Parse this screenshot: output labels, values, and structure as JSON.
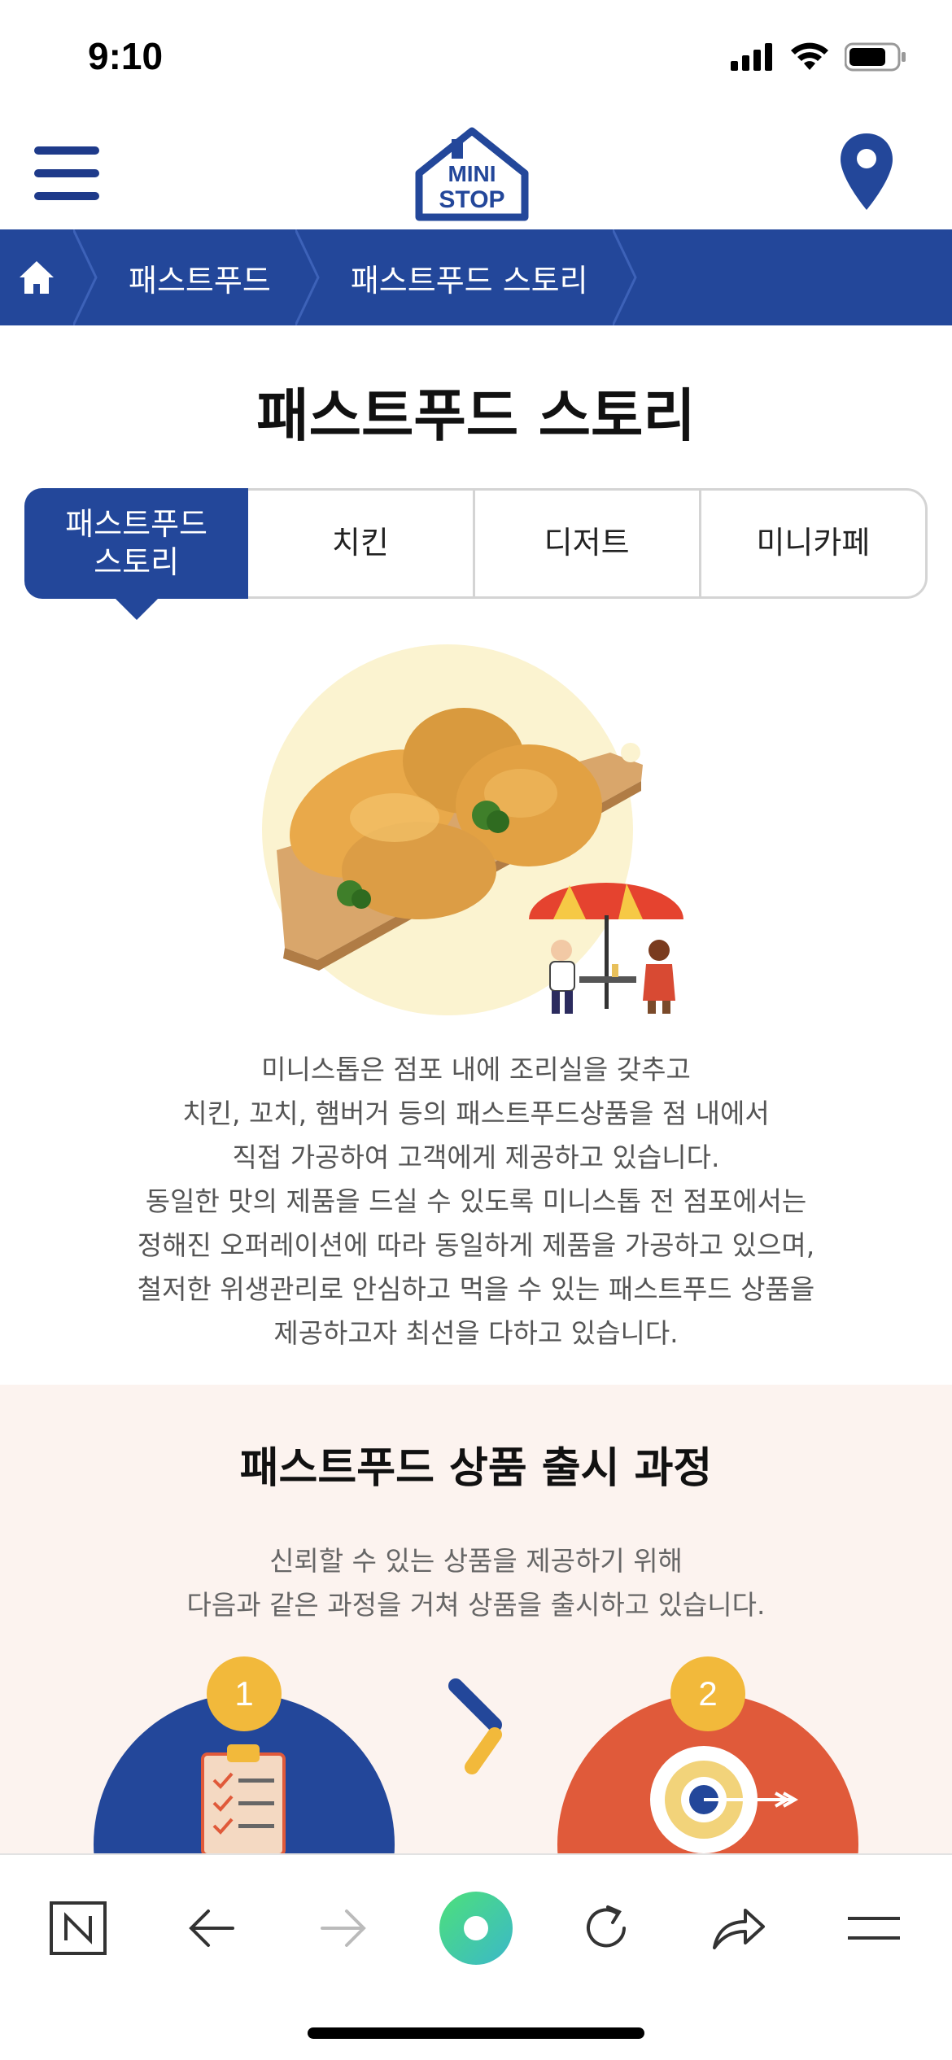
{
  "status_bar": {
    "time": "9:10"
  },
  "header": {
    "logo_text_top": "MINI",
    "logo_text_bottom": "STOP"
  },
  "breadcrumb": {
    "items": [
      "패스트푸드",
      "패스트푸드 스토리"
    ]
  },
  "page": {
    "title": "패스트푸드 스토리"
  },
  "tabs": [
    {
      "label": "패스트푸드\n스토리",
      "active": true
    },
    {
      "label": "치킨",
      "active": false
    },
    {
      "label": "디저트",
      "active": false
    },
    {
      "label": "미니카페",
      "active": false
    }
  ],
  "intro": {
    "lines": [
      "미니스톱은 점포 내에 조리실을 갖추고",
      "치킨, 꼬치, 햄버거 등의 패스트푸드상품을 점 내에서",
      "직접 가공하여 고객에게 제공하고 있습니다.",
      "동일한 맛의 제품을 드실 수 있도록 미니스톱 전 점포에서는",
      "정해진 오퍼레이션에 따라 동일하게 제품을 가공하고 있으며,",
      "철저한 위생관리로 안심하고 먹을 수 있는 패스트푸드 상품을",
      "제공하고자 최선을 다하고 있습니다."
    ]
  },
  "process": {
    "title": "패스트푸드 상품 출시 과정",
    "desc_lines": [
      "신뢰할 수 있는 상품을 제공하기 위해",
      "다음과 같은 과정을 거쳐 상품을 출시하고 있습니다."
    ],
    "steps": [
      "1",
      "2"
    ]
  },
  "colors": {
    "brand_blue": "#23479a",
    "step_orange": "#e05a3a",
    "step_badge": "#f2b93b",
    "section_bg": "#fcf3ef"
  },
  "toolbar": {
    "icons": [
      "naver-n-icon",
      "back-arrow-icon",
      "forward-arrow-icon",
      "green-home-icon",
      "reload-icon",
      "share-icon",
      "menu-icon"
    ]
  }
}
